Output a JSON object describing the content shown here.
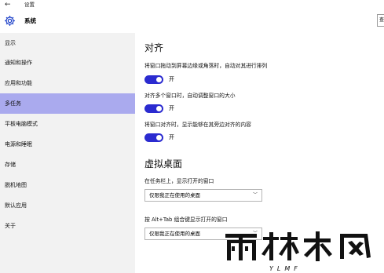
{
  "titlebar": {
    "back_icon": "back-arrow-icon",
    "title": "设置"
  },
  "header": {
    "section_icon": "gear-icon",
    "section_title": "系统",
    "search_partial": "查"
  },
  "sidebar": {
    "items": [
      {
        "label": "显示",
        "active": false
      },
      {
        "label": "通知和操作",
        "active": false
      },
      {
        "label": "应用和功能",
        "active": false
      },
      {
        "label": "多任务",
        "active": true
      },
      {
        "label": "平板电脑模式",
        "active": false
      },
      {
        "label": "电源和睡眠",
        "active": false
      },
      {
        "label": "存储",
        "active": false
      },
      {
        "label": "脱机地图",
        "active": false
      },
      {
        "label": "默认应用",
        "active": false
      },
      {
        "label": "关于",
        "active": false
      }
    ],
    "active_color": "#aaaaee"
  },
  "snap": {
    "heading": "对齐",
    "settings": [
      {
        "description": "将窗口拖动到屏幕边缘或角落时，自动对其进行排列",
        "state": "开",
        "on": true
      },
      {
        "description": "对齐多个窗口时，自动调整窗口的大小",
        "state": "开",
        "on": true
      },
      {
        "description": "将窗口对齐时，显示能够在其旁边对齐的内容",
        "state": "开",
        "on": true
      }
    ],
    "toggle_color": "#2b2bd0"
  },
  "virtual_desktops": {
    "heading": "虚拟桌面",
    "taskbar_label": "在任务栏上，显示打开的窗口",
    "taskbar_value": "仅限我正在使用的桌面",
    "alttab_label": "按 Alt+Tab 组合键显示打开的窗口",
    "alttab_value": "仅限我正在使用的桌面"
  },
  "watermark": {
    "text": "雨林木风",
    "subtext": "YLMF"
  }
}
